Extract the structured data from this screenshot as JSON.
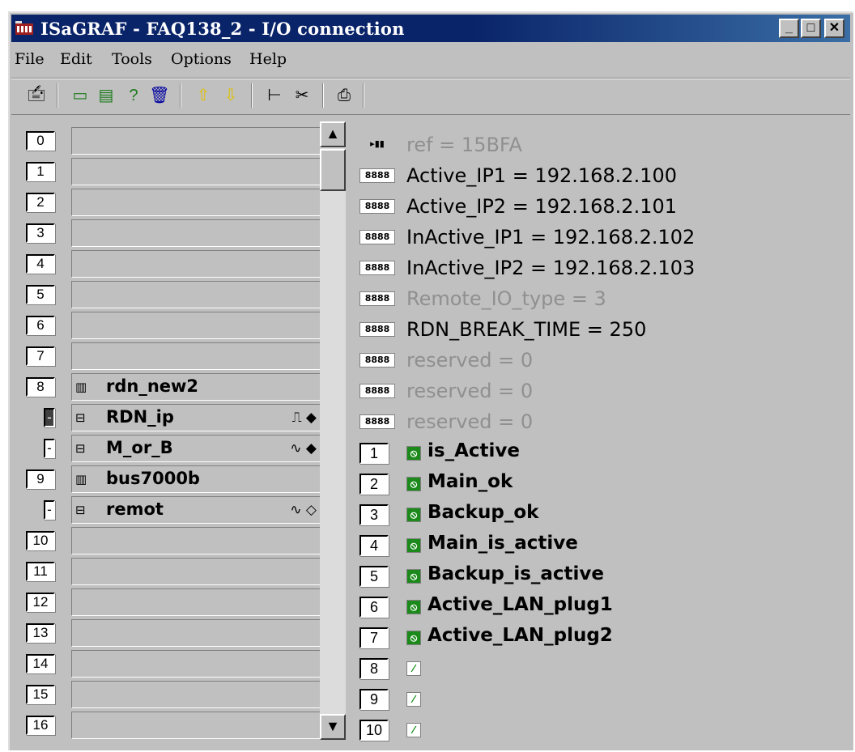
{
  "window": {
    "title": "ISaGRAF - FAQ138_2 - I/O connection",
    "controls": [
      "_",
      "□",
      "✕"
    ]
  },
  "menu": [
    "File",
    "Edit",
    "Tools",
    "Options",
    "Help"
  ],
  "toolbar": {
    "icons": [
      "open-board-icon",
      "connect-board-icon",
      "set-parameters-icon",
      "help-board-icon",
      "delete-icon",
      "move-up-icon",
      "move-down-icon",
      "tree-icon",
      "cut-icon",
      "print-icon"
    ]
  },
  "slots": [
    {
      "num": "0",
      "name": ""
    },
    {
      "num": "1",
      "name": ""
    },
    {
      "num": "2",
      "name": ""
    },
    {
      "num": "3",
      "name": ""
    },
    {
      "num": "4",
      "name": ""
    },
    {
      "num": "5",
      "name": ""
    },
    {
      "num": "6",
      "name": ""
    },
    {
      "num": "7",
      "name": ""
    },
    {
      "num": "8",
      "name": "rdn_new2",
      "icon": "board-icon"
    },
    {
      "num": "-",
      "name": "RDN_ip",
      "icon": "sub-board-icon",
      "signal": "⎍ ◆",
      "selected": true
    },
    {
      "num": "-",
      "name": "M_or_B",
      "icon": "sub-board-icon",
      "signal": "∿ ◆"
    },
    {
      "num": "9",
      "name": "bus7000b",
      "icon": "board-icon"
    },
    {
      "num": "-",
      "name": "remot",
      "icon": "sub-board-icon",
      "signal": "∿ ◇"
    },
    {
      "num": "10",
      "name": ""
    },
    {
      "num": "11",
      "name": ""
    },
    {
      "num": "12",
      "name": ""
    },
    {
      "num": "13",
      "name": ""
    },
    {
      "num": "14",
      "name": ""
    },
    {
      "num": "15",
      "name": ""
    },
    {
      "num": "16",
      "name": ""
    }
  ],
  "params": [
    {
      "label": "ref = 15BFA",
      "grey": true,
      "icon": "▸▮▮"
    },
    {
      "label": "Active_IP1 = 192.168.2.100",
      "grey": false,
      "icon": "8888"
    },
    {
      "label": "Active_IP2 = 192.168.2.101",
      "grey": false,
      "icon": "8888"
    },
    {
      "label": "InActive_IP1 = 192.168.2.102",
      "grey": false,
      "icon": "8888"
    },
    {
      "label": "InActive_IP2 = 192.168.2.103",
      "grey": false,
      "icon": "8888"
    },
    {
      "label": "Remote_IO_type = 3",
      "grey": true,
      "icon": "8888"
    },
    {
      "label": "RDN_BREAK_TIME = 250",
      "grey": false,
      "icon": "8888"
    },
    {
      "label": "reserved = 0",
      "grey": true,
      "icon": "8888"
    },
    {
      "label": "reserved = 0",
      "grey": true,
      "icon": "8888"
    },
    {
      "label": "reserved = 0",
      "grey": true,
      "icon": "8888"
    }
  ],
  "channels": [
    {
      "num": "1",
      "var": "is_Active",
      "on": true
    },
    {
      "num": "2",
      "var": "Main_ok",
      "on": true
    },
    {
      "num": "3",
      "var": "Backup_ok",
      "on": true
    },
    {
      "num": "4",
      "var": "Main_is_active",
      "on": true
    },
    {
      "num": "5",
      "var": "Backup_is_active",
      "on": true
    },
    {
      "num": "6",
      "var": "Active_LAN_plug1",
      "on": true
    },
    {
      "num": "7",
      "var": "Active_LAN_plug2",
      "on": true
    },
    {
      "num": "8",
      "var": "",
      "on": false
    },
    {
      "num": "9",
      "var": "",
      "on": false
    },
    {
      "num": "10",
      "var": "",
      "on": false
    }
  ]
}
